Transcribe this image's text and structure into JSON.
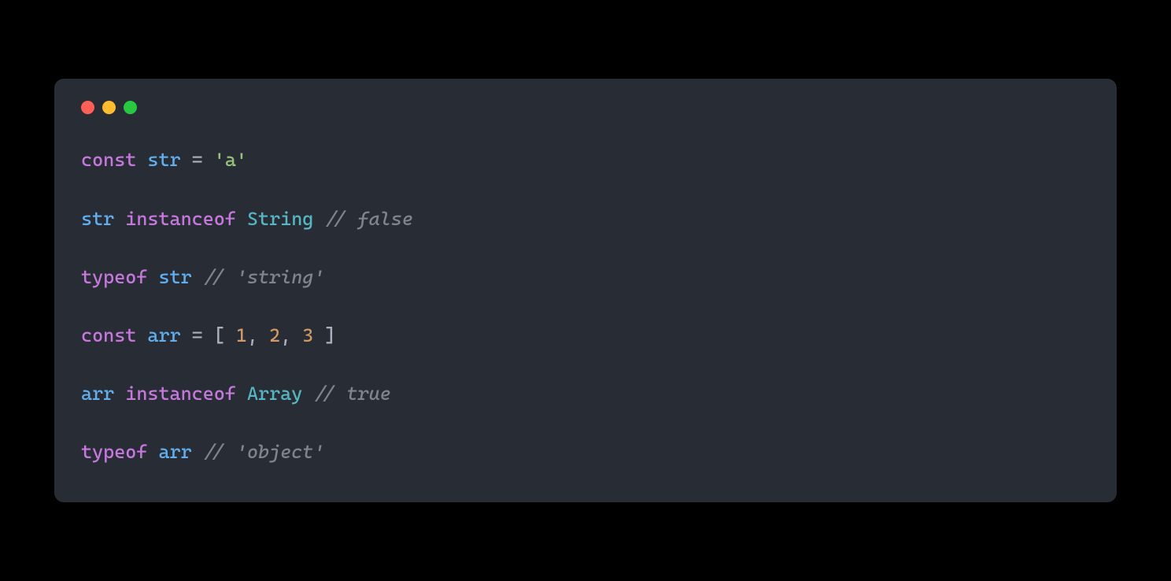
{
  "traffic_lights": [
    "close",
    "minimize",
    "zoom"
  ],
  "code": {
    "lines": [
      {
        "tokens": [
          {
            "cls": "keyword",
            "t": "const"
          },
          {
            "cls": "punct",
            "t": " "
          },
          {
            "cls": "ident",
            "t": "str"
          },
          {
            "cls": "punct",
            "t": " "
          },
          {
            "cls": "operator",
            "t": "="
          },
          {
            "cls": "punct",
            "t": " "
          },
          {
            "cls": "string",
            "t": "'a'"
          }
        ]
      },
      {
        "tokens": [
          {
            "cls": "ident",
            "t": "str"
          },
          {
            "cls": "punct",
            "t": " "
          },
          {
            "cls": "keyword",
            "t": "instanceof"
          },
          {
            "cls": "punct",
            "t": " "
          },
          {
            "cls": "type",
            "t": "String"
          },
          {
            "cls": "punct",
            "t": " "
          },
          {
            "cls": "comment",
            "t": "// false"
          }
        ]
      },
      {
        "tokens": [
          {
            "cls": "keyword",
            "t": "typeof"
          },
          {
            "cls": "punct",
            "t": " "
          },
          {
            "cls": "ident",
            "t": "str"
          },
          {
            "cls": "punct",
            "t": " "
          },
          {
            "cls": "comment",
            "t": "// 'string'"
          }
        ]
      },
      {
        "tokens": [
          {
            "cls": "keyword",
            "t": "const"
          },
          {
            "cls": "punct",
            "t": " "
          },
          {
            "cls": "ident",
            "t": "arr"
          },
          {
            "cls": "punct",
            "t": " "
          },
          {
            "cls": "operator",
            "t": "="
          },
          {
            "cls": "punct",
            "t": " "
          },
          {
            "cls": "punct",
            "t": "[ "
          },
          {
            "cls": "number",
            "t": "1"
          },
          {
            "cls": "punct",
            "t": ", "
          },
          {
            "cls": "number",
            "t": "2"
          },
          {
            "cls": "punct",
            "t": ", "
          },
          {
            "cls": "number",
            "t": "3"
          },
          {
            "cls": "punct",
            "t": " ]"
          }
        ]
      },
      {
        "tokens": [
          {
            "cls": "ident",
            "t": "arr"
          },
          {
            "cls": "punct",
            "t": " "
          },
          {
            "cls": "keyword",
            "t": "instanceof"
          },
          {
            "cls": "punct",
            "t": " "
          },
          {
            "cls": "type",
            "t": "Array"
          },
          {
            "cls": "punct",
            "t": " "
          },
          {
            "cls": "comment",
            "t": "// true"
          }
        ]
      },
      {
        "tokens": [
          {
            "cls": "keyword",
            "t": "typeof"
          },
          {
            "cls": "punct",
            "t": " "
          },
          {
            "cls": "ident",
            "t": "arr"
          },
          {
            "cls": "punct",
            "t": " "
          },
          {
            "cls": "comment",
            "t": "// 'object'"
          }
        ]
      }
    ]
  }
}
